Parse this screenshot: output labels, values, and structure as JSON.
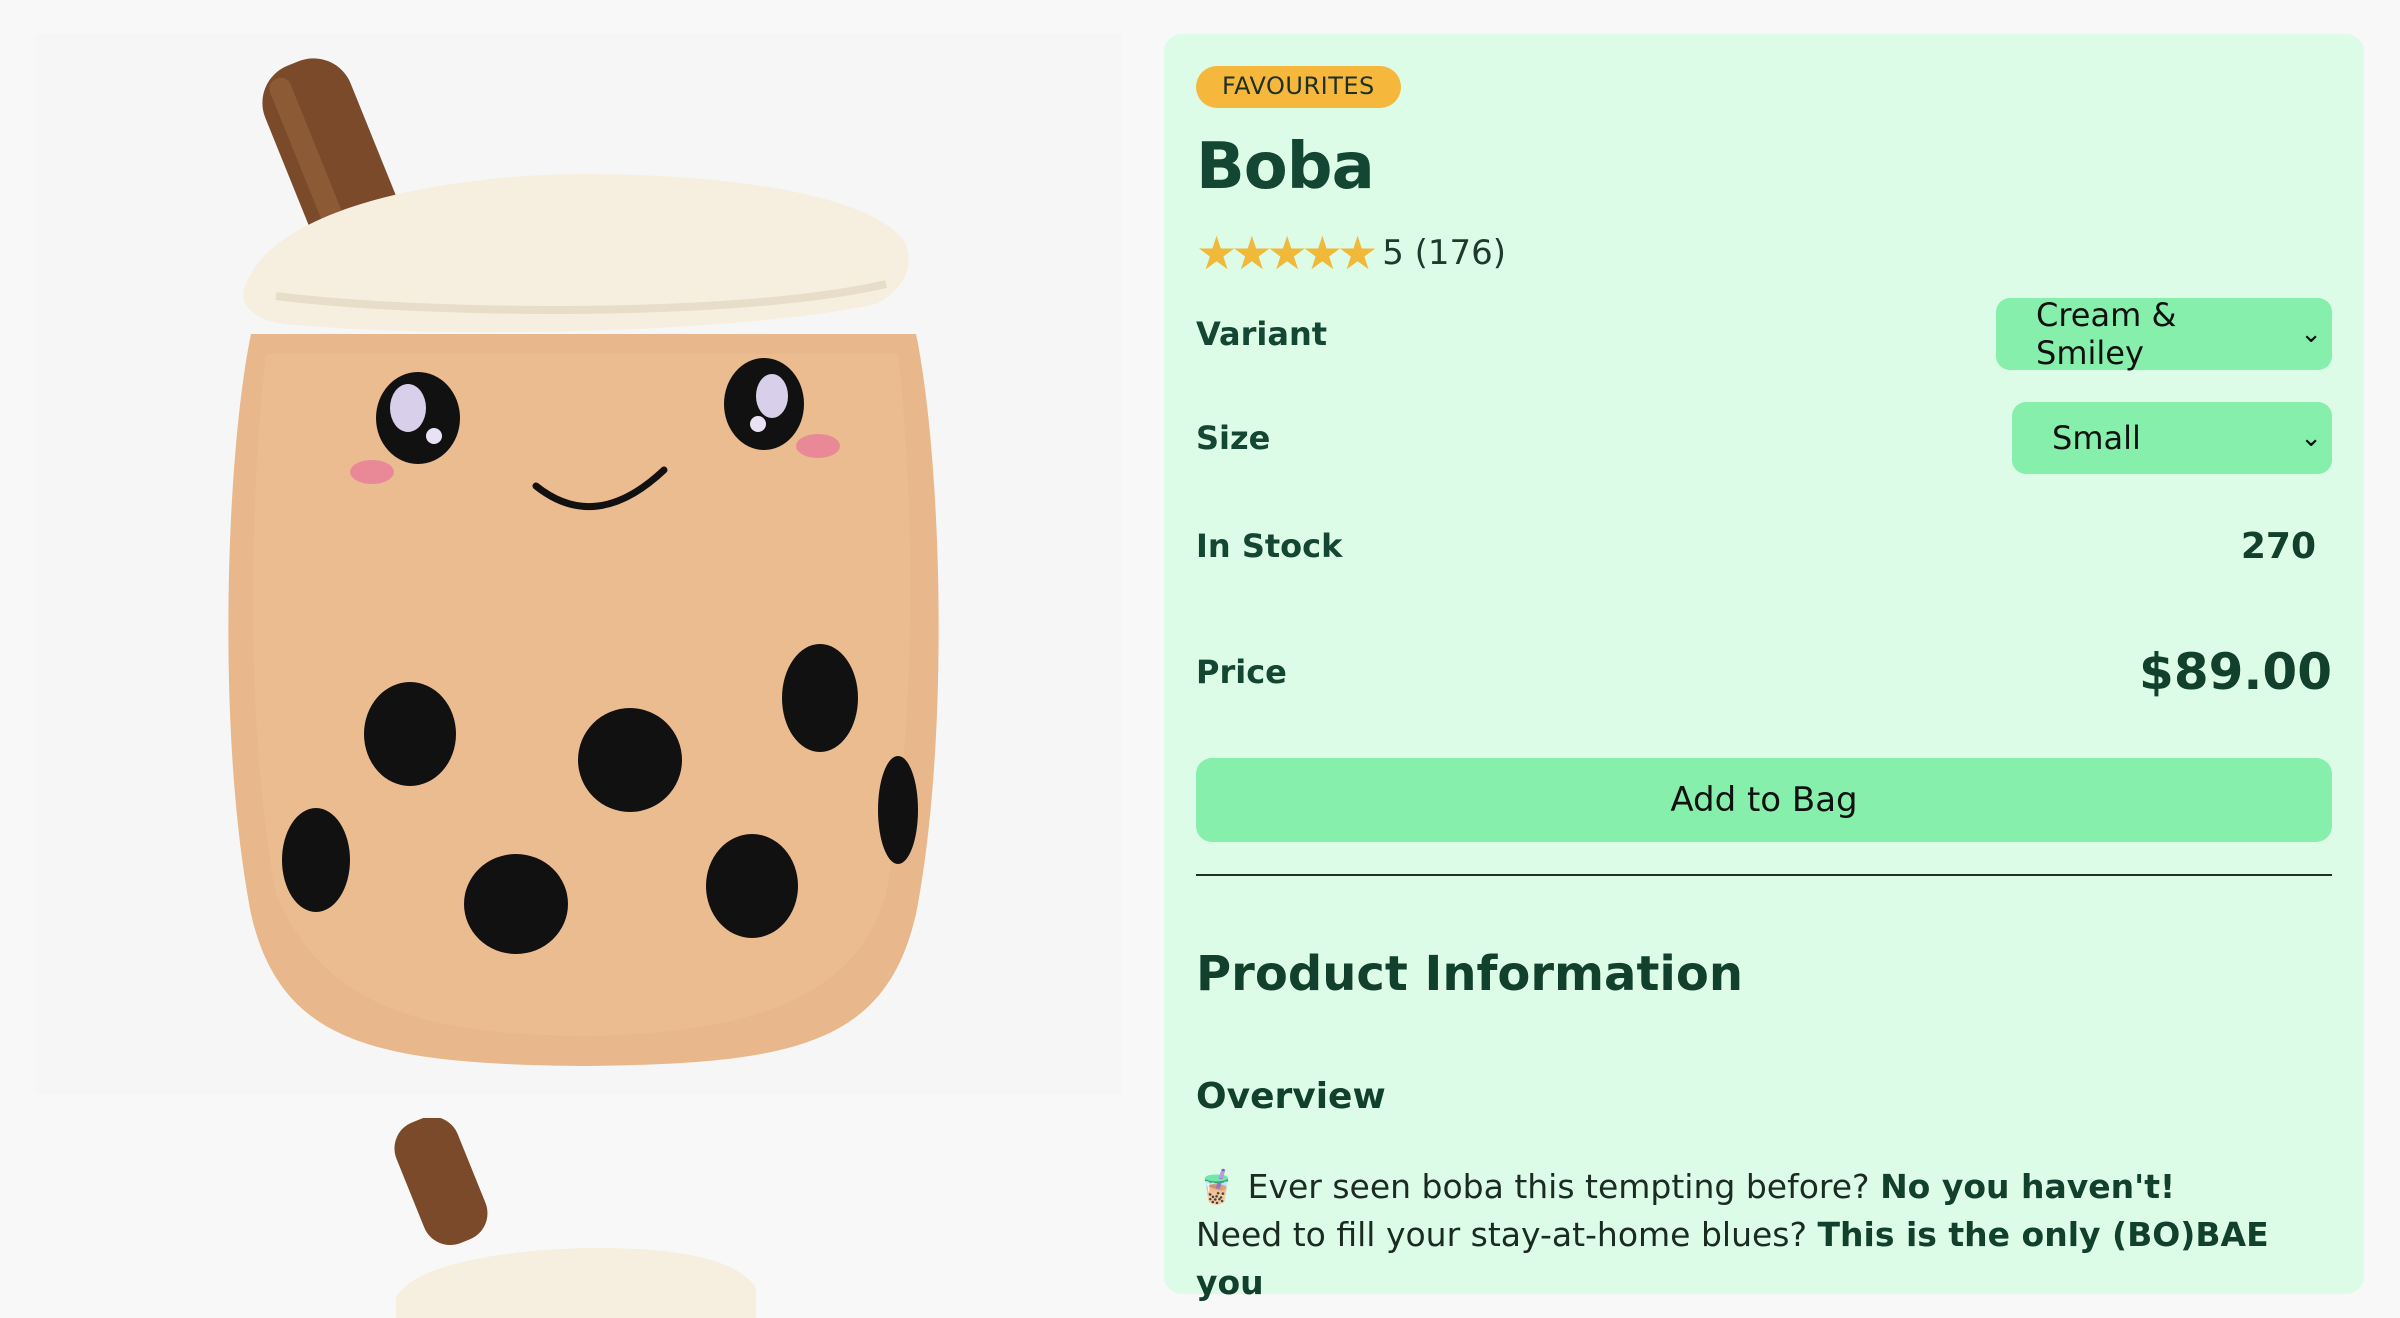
{
  "gallery": {
    "main_image_alt": "Boba plush",
    "thumb_image_alt": "Boba plush thumbnail"
  },
  "product": {
    "badge": "FAVOURITES",
    "title": "Boba",
    "rating_stars": "★★★★★",
    "rating_text": "5 (176)",
    "variant": {
      "label": "Variant",
      "value": "Cream & Smiley",
      "chevron": "⌄"
    },
    "size": {
      "label": "Size",
      "value": "Small",
      "chevron": "⌄"
    },
    "stock": {
      "label": "In Stock",
      "value": "270"
    },
    "price": {
      "label": "Price",
      "value": "$89.00"
    },
    "cta": "Add to Bag"
  },
  "info": {
    "heading": "Product Information",
    "overview_heading": "Overview",
    "line1_emoji": "🧋",
    "line1_text": "Ever seen boba this tempting before?",
    "line1_bold": "No you haven't!",
    "line2_text": "Need to fill your stay-at-home blues?",
    "line2_bold": "This is the only (BO)BAE you"
  },
  "colors": {
    "panel_bg": "#dcfce7",
    "accent_green": "#86efac",
    "badge_yellow": "#f5b83d",
    "text_dark_green": "#134733",
    "star": "#f0b93a"
  },
  "icons": [
    "star-icon",
    "chevron-down-icon"
  ]
}
